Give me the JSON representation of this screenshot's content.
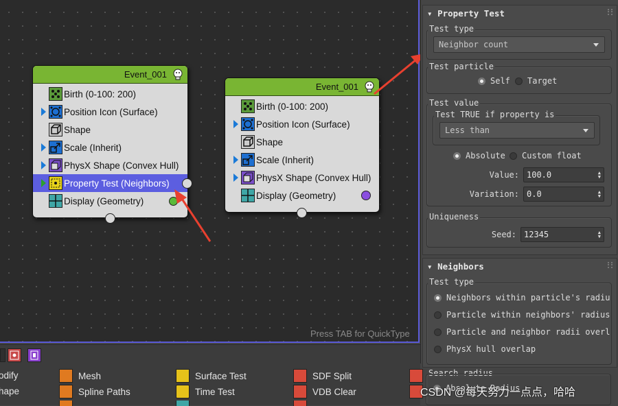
{
  "canvas": {
    "hint": "Press TAB for QuickType"
  },
  "node1": {
    "title": "Event_001",
    "operators": [
      {
        "label": "Birth (0-100: 200)",
        "icon": "birth-icon"
      },
      {
        "label": "Position Icon (Surface)",
        "icon": "position-icon"
      },
      {
        "label": "Shape",
        "icon": "shape-icon"
      },
      {
        "label": "Scale (Inherit)",
        "icon": "scale-icon"
      },
      {
        "label": "PhysX Shape (Convex Hull)",
        "icon": "physx-shape-icon"
      },
      {
        "label": "Property Test (Neighbors)",
        "icon": "property-test-icon",
        "selected": true
      },
      {
        "label": "Display (Geometry)",
        "icon": "display-icon"
      }
    ]
  },
  "node2": {
    "title": "Event_001",
    "operators": [
      {
        "label": "Birth (0-100: 200)",
        "icon": "birth-icon"
      },
      {
        "label": "Position Icon (Surface)",
        "icon": "position-icon"
      },
      {
        "label": "Shape",
        "icon": "shape-icon"
      },
      {
        "label": "Scale (Inherit)",
        "icon": "scale-icon"
      },
      {
        "label": "PhysX Shape (Convex Hull)",
        "icon": "physx-shape-icon"
      },
      {
        "label": "Display (Geometry)",
        "icon": "display-icon"
      }
    ]
  },
  "property_test": {
    "title": "Property Test",
    "test_type_label": "Test type",
    "test_type_value": "Neighbor count",
    "test_particle_label": "Test particle",
    "test_particle_options": [
      "Self",
      "Target"
    ],
    "test_particle_selected": "Self",
    "test_value_label": "Test value",
    "test_true_label": "Test TRUE if property is",
    "comparison_value": "Less than",
    "value_mode_options": [
      "Absolute",
      "Custom float"
    ],
    "value_mode_selected": "Absolute",
    "value_label": "Value:",
    "value": "100.0",
    "variation_label": "Variation:",
    "variation": "0.0",
    "uniqueness_label": "Uniqueness",
    "seed_label": "Seed:",
    "seed": "12345"
  },
  "neighbors": {
    "title": "Neighbors",
    "test_type_label": "Test type",
    "options": [
      "Neighbors within particle's radiu",
      "Particle within neighbors' radius",
      "Particle and neighbor radii overl",
      "PhysX hull overlap"
    ],
    "selected": "Neighbors within particle's radiu",
    "search_radius_label": "Search radius",
    "search_radius_option": "Absolute Radius"
  },
  "depot": {
    "col1": [
      "odify",
      "hape"
    ],
    "col2": [
      "Mesh",
      "Spline Paths"
    ],
    "col3": [
      "Surface Test",
      "Time Test"
    ],
    "col4": [
      "SDF Split",
      "VDB Clear"
    ]
  },
  "watermark": "CSDN @每天努力一点点，哈哈",
  "colors": {
    "header_green": "#79b533",
    "selected_blue": "#5c5ee0",
    "annotation_red": "#e8402f"
  }
}
